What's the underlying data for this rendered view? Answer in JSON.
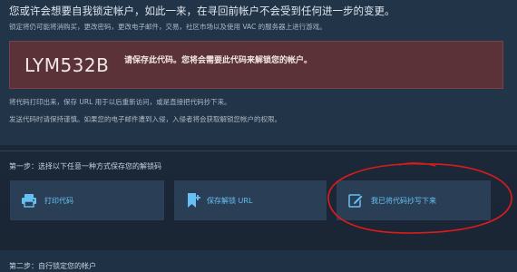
{
  "header": {
    "headline": "您或许会想要自我锁定帐户，如此一来，在寻回前帐户不会受到任何进一步的变更。",
    "subline": "锁定将仍可能将消购买，更改密码，更改电子邮件，交易，社区市场以及使用 VAC 的服务器上进行游戏。"
  },
  "recovery_code": {
    "value": "LYM532B",
    "note": "请保存此代码。您将会需要此代码来解锁您的帐户。"
  },
  "info": {
    "line1": "将代码打印出来，保存 URL 用于以后重新访问，或是直接把代码抄下来。",
    "line2": "发送代码时请保持谨慎。如果您的电子邮件遭到入侵，入侵者将会获取解锁您帐户的权限。"
  },
  "step1": {
    "title": "第一步：选择以下任意一种方式保存您的解锁码",
    "options": [
      {
        "label": "打印代码",
        "icon": "printer-icon"
      },
      {
        "label": "保存解锁 URL",
        "icon": "bookmark-icon"
      },
      {
        "label": "我已将代码抄写下来",
        "icon": "edit-icon"
      }
    ]
  },
  "step2": {
    "title": "第二步：自行锁定您的帐户"
  },
  "colors": {
    "accent": "#66c0f4",
    "code_box": "#5b3237",
    "annotation": "#e01a1a"
  }
}
